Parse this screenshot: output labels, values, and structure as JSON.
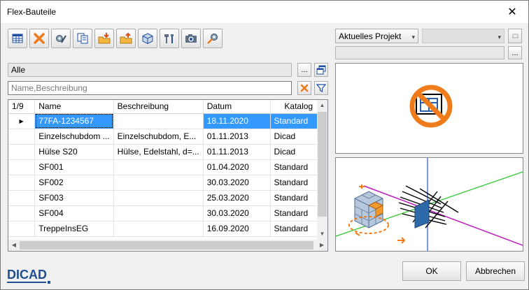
{
  "window": {
    "title": "Flex-Bauteile",
    "close_glyph": "✕"
  },
  "toolbar": {
    "buttons": [
      {
        "name": "table-icon"
      },
      {
        "name": "delete-icon"
      },
      {
        "name": "edit-parts-icon"
      },
      {
        "name": "copy-icon"
      },
      {
        "name": "import-icon"
      },
      {
        "name": "export-icon"
      },
      {
        "name": "3d-part-icon"
      },
      {
        "name": "tools-icon"
      },
      {
        "name": "camera-icon"
      },
      {
        "name": "settings-icon"
      }
    ]
  },
  "filter": {
    "category_value": "Alle",
    "browse_label": "...",
    "search_placeholder": "Name,Beschreibung"
  },
  "project": {
    "select_value": "Aktuelles Projekt",
    "small_btn_label": "...",
    "arrow": "▾"
  },
  "grid": {
    "counter": "1/9",
    "columns": [
      "Name",
      "Beschreibung",
      "Datum",
      "Katalog"
    ],
    "rows": [
      {
        "name": "77FA-1234567",
        "desc": "",
        "date": "18.11.2020",
        "catalog": "Standard",
        "selected": true
      },
      {
        "name": "Einzelschubdom ...",
        "desc": "Einzelschubdom, E...",
        "date": "01.11.2013",
        "catalog": "Dicad"
      },
      {
        "name": "Hülse S20",
        "desc": "Hülse, Edelstahl, d=...",
        "date": "01.11.2013",
        "catalog": "Dicad"
      },
      {
        "name": "SF001",
        "desc": "",
        "date": "01.04.2020",
        "catalog": "Standard"
      },
      {
        "name": "SF002",
        "desc": "",
        "date": "30.03.2020",
        "catalog": "Standard"
      },
      {
        "name": "SF003",
        "desc": "",
        "date": "25.03.2020",
        "catalog": "Standard"
      },
      {
        "name": "SF004",
        "desc": "",
        "date": "30.03.2020",
        "catalog": "Standard"
      },
      {
        "name": "TreppeInsEG",
        "desc": "",
        "date": "16.09.2020",
        "catalog": "Standard"
      }
    ]
  },
  "buttons": {
    "ok": "OK",
    "cancel": "Abbrechen"
  },
  "logo": {
    "text": "DICAD"
  },
  "colors": {
    "selection": "#3399ff",
    "logo_blue": "#1d4f91",
    "no_entry_orange": "#f07b1a"
  }
}
